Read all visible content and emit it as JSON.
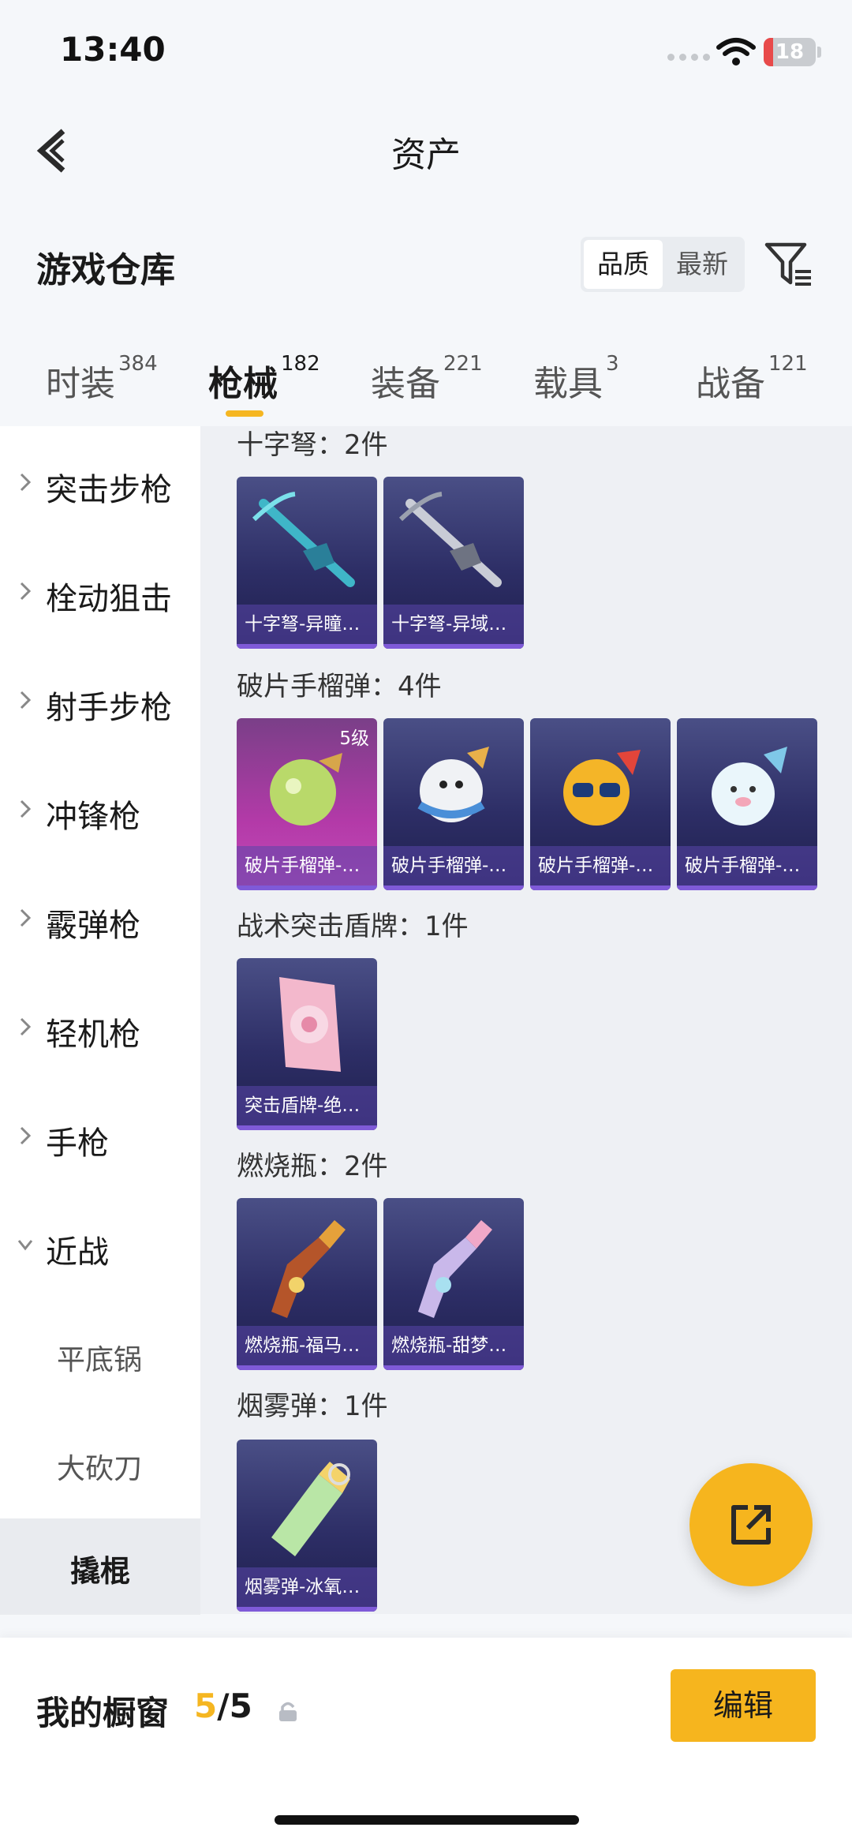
{
  "status_bar": {
    "time": "13:40",
    "battery_level": "18",
    "battery_color": "#e84a4a"
  },
  "header": {
    "title": "资产",
    "back_icon": "back-arrow-icon"
  },
  "section": {
    "title": "游戏仓库",
    "sort_options": [
      "品质",
      "最新"
    ],
    "sort_selected": "品质",
    "filter_icon": "filter-icon"
  },
  "tabs": [
    {
      "label": "时装",
      "count": "384"
    },
    {
      "label": "枪械",
      "count": "182",
      "active": true
    },
    {
      "label": "装备",
      "count": "221"
    },
    {
      "label": "载具",
      "count": "3"
    },
    {
      "label": "战备",
      "count": "121"
    }
  ],
  "sidebar": {
    "categories": [
      {
        "label": "突击步枪",
        "expanded": false
      },
      {
        "label": "栓动狙击",
        "expanded": false
      },
      {
        "label": "射手步枪",
        "expanded": false
      },
      {
        "label": "冲锋枪",
        "expanded": false
      },
      {
        "label": "霰弹枪",
        "expanded": false
      },
      {
        "label": "轻机枪",
        "expanded": false
      },
      {
        "label": "手枪",
        "expanded": false
      },
      {
        "label": "近战",
        "expanded": true
      }
    ],
    "subitems": [
      "平底锅",
      "大砍刀"
    ],
    "selected": "撬棍"
  },
  "groups": [
    {
      "title": "十字弩：2件",
      "items": [
        {
          "name": "十字弩-异瞳…",
          "art": "crossbow"
        },
        {
          "name": "十字弩-异域…",
          "art": "crossbow-gray"
        }
      ]
    },
    {
      "title": "破片手榴弹：4件",
      "items": [
        {
          "name": "破片手榴弹-…",
          "art": "grenade-green",
          "level": "5级",
          "rare": true
        },
        {
          "name": "破片手榴弹-…",
          "art": "grenade-snowman"
        },
        {
          "name": "破片手榴弹-…",
          "art": "grenade-sunglasses"
        },
        {
          "name": "破片手榴弹-…",
          "art": "grenade-seal"
        }
      ]
    },
    {
      "title": "战术突击盾牌：1件",
      "items": [
        {
          "name": "突击盾牌-绝…",
          "art": "shield-pink"
        }
      ]
    },
    {
      "title": "燃烧瓶：2件",
      "items": [
        {
          "name": "燃烧瓶-福马…",
          "art": "bottle-brown"
        },
        {
          "name": "燃烧瓶-甜梦…",
          "art": "bottle-pastel"
        }
      ]
    },
    {
      "title": "烟雾弹：1件",
      "items": [
        {
          "name": "烟雾弹-冰氧…",
          "art": "smoke-green"
        }
      ]
    }
  ],
  "fab": {
    "icon": "share-external-icon"
  },
  "bottom_bar": {
    "showcase_label": "我的橱窗",
    "showcase_current": "5",
    "showcase_total": "/5",
    "edit_label": "编辑",
    "accent_color": "#f6b51e"
  }
}
